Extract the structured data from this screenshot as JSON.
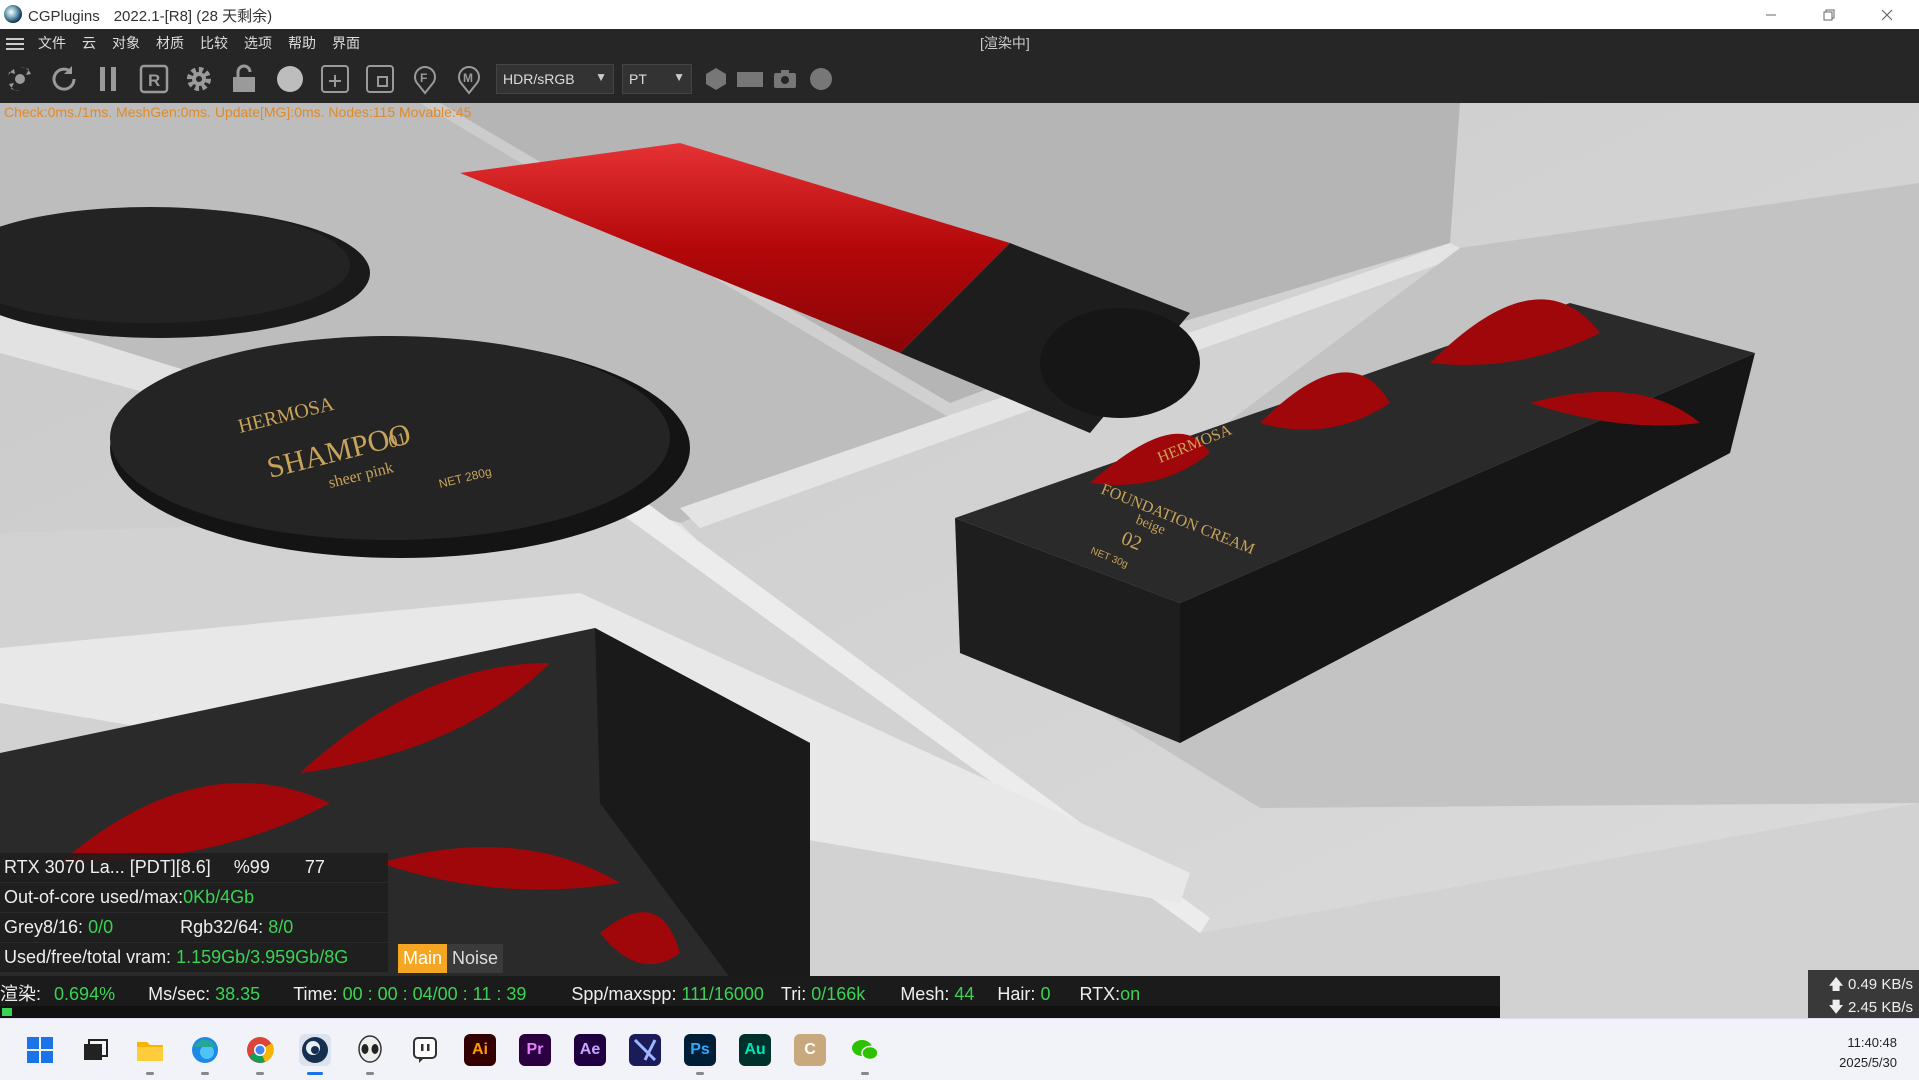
{
  "window": {
    "app_name": "CGPlugins",
    "version": "2022.1-[R8] (28 天剩余)"
  },
  "menu": {
    "items": [
      "文件",
      "云",
      "对象",
      "材质",
      "比较",
      "选项",
      "帮助",
      "界面"
    ],
    "status": "[渲染中]"
  },
  "toolbar": {
    "color_mode": "HDR/sRGB",
    "kernel": "PT",
    "icons": [
      "reset-render-icon",
      "refresh-icon",
      "pause-icon",
      "region-icon",
      "settings-icon",
      "lock-icon",
      "material-ball-icon",
      "add-box-icon",
      "frame-icon",
      "focus-pick-icon",
      "material-pick-icon",
      "hexagon-icon",
      "rectangle-icon",
      "camera-icon",
      "circle-icon"
    ]
  },
  "info_line": "Check:0ms./1ms. MeshGen:0ms. Update[MG]:0ms. Nodes:115 Movable:45",
  "viewport": {
    "labels": {
      "shampoo_brand": "HERMOSA",
      "shampoo": "SHAMPOO",
      "shampoo_shade": "sheer pink",
      "shampoo_num": "01",
      "shampoo_net": "NET 280g",
      "box_brand": "HERMOSA",
      "box_product": "FOUNDATION CREAM",
      "box_shade": "beige",
      "box_num": "02",
      "box_net": "NET 30g"
    }
  },
  "overlay": {
    "gpu_name": "RTX 3070 La... [PDT][8.6]",
    "gpu_percent": "%99",
    "gpu_temp": "77",
    "ooc_label": "Out-of-core used/max:",
    "ooc_value": "0Kb/4Gb",
    "grey_label": "Grey8/16:",
    "grey_value": "0/0",
    "rgb_label": "Rgb32/64:",
    "rgb_value": "8/0",
    "vram_label": "Used/free/total vram:",
    "vram_value": "1.159Gb/3.959Gb/8G"
  },
  "tabs": [
    "Main",
    "Noise"
  ],
  "stats": {
    "render_label": "渲染:",
    "render_value": "0.694%",
    "ms_label": "Ms/sec:",
    "ms_value": "38.35",
    "time_label": "Time:",
    "time_value": "00 : 00 : 04/00 : 11 : 39",
    "spp_label": "Spp/maxspp:",
    "spp_value": "111/16000",
    "tri_label": "Tri:",
    "tri_value": "0/166k",
    "mesh_label": "Mesh:",
    "mesh_value": "44",
    "hair_label": "Hair:",
    "hair_value": "0",
    "rtx_label": "RTX:",
    "rtx_value": "on"
  },
  "progress": 0.00694,
  "network": {
    "up": "0.49 KB/s",
    "down": "2.45 KB/s"
  },
  "taskbar": {
    "apps": [
      "start-icon",
      "task-view-icon",
      "file-explorer-icon",
      "edge-icon",
      "chrome-icon",
      "cinema4d-icon",
      "alien-app-icon",
      "twitch-icon",
      "illustrator-icon",
      "premiere-icon",
      "after-effects-icon",
      "vegas-icon",
      "photoshop-icon",
      "audition-icon",
      "c-app-icon",
      "wechat-icon"
    ],
    "ai": "Ai",
    "pr": "Pr",
    "ae": "Ae",
    "ps": "Ps",
    "au": "Au",
    "c": "C"
  },
  "clock": {
    "time": "11:40:48",
    "date": "2025/5/30"
  },
  "colors": {
    "accent_green": "#39d353",
    "info_orange": "#e08a2a",
    "tab_active": "#f5a623",
    "product_red": "#b3070a"
  }
}
